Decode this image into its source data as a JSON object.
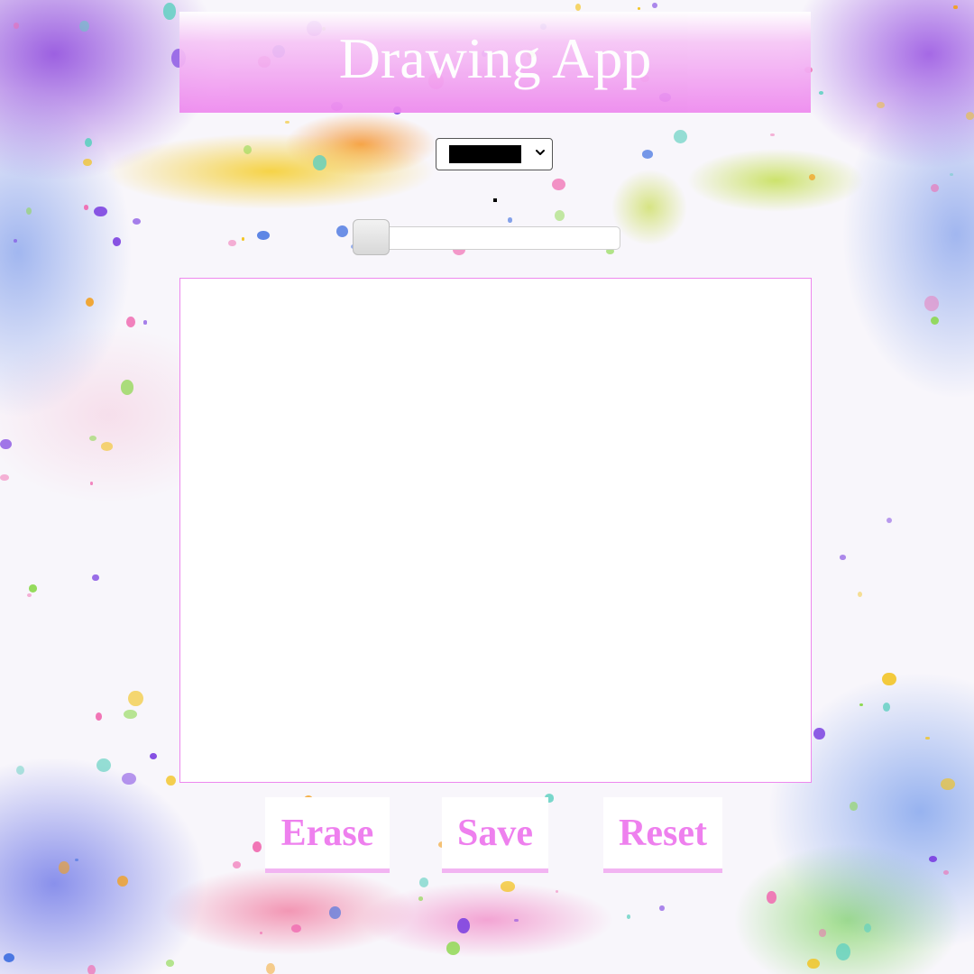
{
  "app": {
    "title": "Drawing App"
  },
  "toolbar": {
    "color_select": {
      "selected_color": "#000000"
    },
    "brush_size": {
      "value_fraction": 0.0
    }
  },
  "actions": {
    "erase_label": "Erase",
    "save_label": "Save",
    "reset_label": "Reset"
  },
  "colors": {
    "accent": "#ee88ee",
    "button_text": "#ee80ee",
    "canvas": "#ffffff"
  }
}
